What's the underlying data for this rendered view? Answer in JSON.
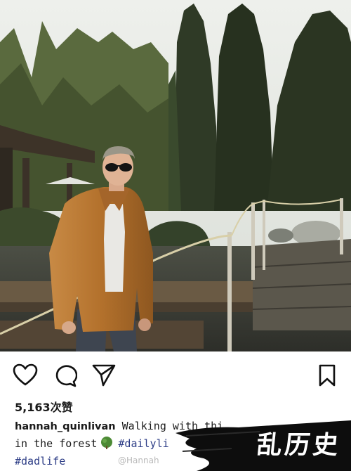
{
  "post": {
    "likes_text": "5,163次赞",
    "username": "hannah_quinlivan",
    "caption_line1": " Walking with thi",
    "caption_line2_a": "in the forest",
    "caption_line2_tag": "#dailyli",
    "caption_line3_tag": "#dadlife"
  },
  "watermark": {
    "weibo": "@Hannah",
    "brush_text": "乱历史"
  },
  "icons": {
    "like": "heart-outline-icon",
    "comment": "speech-bubble-icon",
    "share": "paper-plane-icon",
    "save": "bookmark-icon",
    "emoji": "tree-emoji-icon"
  },
  "colors": {
    "hashtag": "#2d3d86",
    "text": "#1a1a1a",
    "jacket": "#b3712c"
  }
}
